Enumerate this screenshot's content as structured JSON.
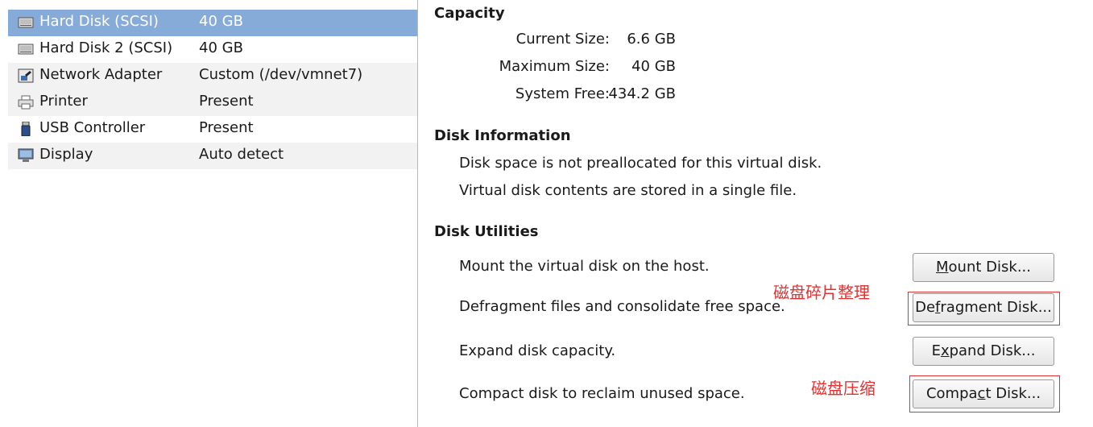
{
  "devices": [
    {
      "name": "Hard Disk (SCSI)",
      "summary": "40 GB",
      "icon": "hard-disk-icon",
      "selected": true
    },
    {
      "name": "Hard Disk 2 (SCSI)",
      "summary": "40 GB",
      "icon": "hard-disk-icon"
    },
    {
      "name": "Network Adapter",
      "summary": "Custom (/dev/vmnet7)",
      "icon": "network-adapter-icon"
    },
    {
      "name": "Printer",
      "summary": "Present",
      "icon": "printer-icon"
    },
    {
      "name": "USB Controller",
      "summary": "Present",
      "icon": "usb-icon"
    },
    {
      "name": "Display",
      "summary": "Auto detect",
      "icon": "display-icon"
    }
  ],
  "capacity": {
    "title": "Capacity",
    "rows": [
      {
        "label": "Current Size:",
        "value": "6.6 GB"
      },
      {
        "label": "Maximum Size:",
        "value": "40 GB"
      },
      {
        "label": "System Free:",
        "value": "434.2 GB"
      }
    ]
  },
  "disk_info": {
    "title": "Disk Information",
    "lines": [
      "Disk space is not preallocated for this virtual disk.",
      "Virtual disk contents are stored in a single file."
    ]
  },
  "utilities": {
    "title": "Disk Utilities",
    "items": [
      {
        "desc": "Mount the virtual disk on the host.",
        "btn_pre": "",
        "btn_key": "M",
        "btn_post": "ount Disk..."
      },
      {
        "desc": "Defragment files and consolidate free space.",
        "btn_pre": "De",
        "btn_key": "f",
        "btn_post": "ragment Disk..."
      },
      {
        "desc": "Expand disk capacity.",
        "btn_pre": "E",
        "btn_key": "x",
        "btn_post": "pand Disk..."
      },
      {
        "desc": "Compact disk to reclaim unused space.",
        "btn_pre": "Compa",
        "btn_key": "c",
        "btn_post": "t Disk..."
      }
    ]
  },
  "annotations": {
    "defrag": "磁盘碎片整理",
    "compact": "磁盘压缩",
    "color": "#e53030"
  },
  "colors": {
    "selected_row": "#86abd9",
    "alt_row": "#f2f2f2"
  }
}
